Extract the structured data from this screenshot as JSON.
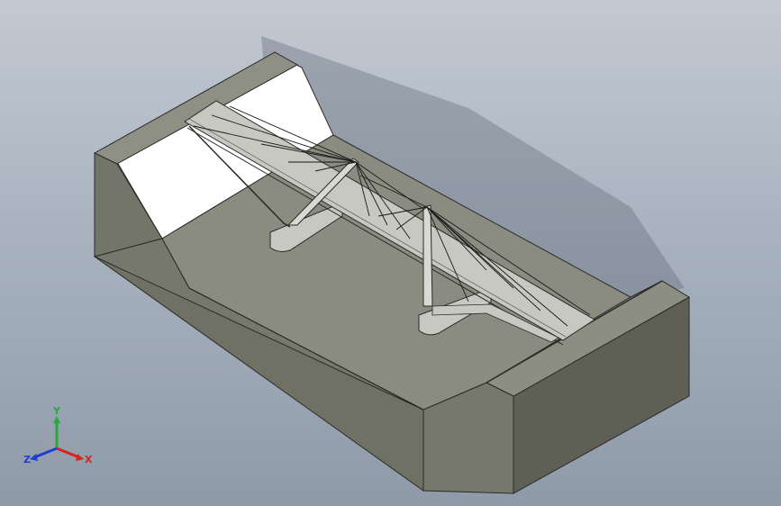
{
  "viewport": {
    "background_top": "#c3c9d2",
    "background_bottom": "#8f9aa9"
  },
  "model": {
    "colors": {
      "terrain_top": "#8a8c80",
      "terrain_side_front": "#6e7062",
      "terrain_side_right": "#5f6155",
      "bank_white": "#ffffff",
      "structure": "#c7c8c0",
      "cable": "#1a1a1a"
    }
  },
  "triad": {
    "x_label": "X",
    "y_label": "Y",
    "z_label": "Z",
    "x_color": "#d0281e",
    "y_color": "#26a83a",
    "z_color": "#1d3fd1"
  }
}
